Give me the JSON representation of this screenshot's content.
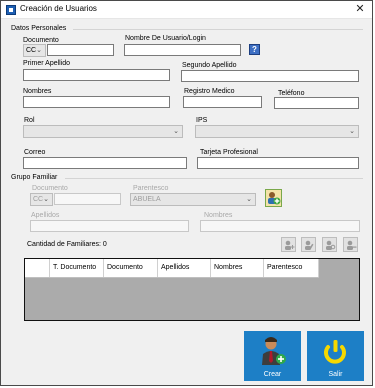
{
  "window": {
    "title": "Creación de Usuarios",
    "close_glyph": "✕"
  },
  "datos_personales": {
    "group_label": "Datos Personales",
    "documento_label": "Documento",
    "documento_tipo": "CC",
    "documento_value": "",
    "nombre_usuario_label": "Nombre De Usuario/Login",
    "nombre_usuario_value": "",
    "help_glyph": "?",
    "primer_apellido_label": "Primer Apellido",
    "segundo_apellido_label": "Segundo Apellido",
    "nombres_label": "Nombres",
    "registro_medico_label": "Registro Medico",
    "telefono_label": "Teléfono",
    "rol_label": "Rol",
    "rol_value": "",
    "ips_label": "IPS",
    "ips_value": "",
    "correo_label": "Correo",
    "tarjeta_profesional_label": "Tarjeta Profesional"
  },
  "grupo_familiar": {
    "group_label": "Grupo Familiar",
    "documento_label": "Documento",
    "documento_tipo": "CC",
    "parentesco_label": "Parentesco",
    "parentesco_value": "ABUELA",
    "apellidos_label": "Apellidos",
    "nombres_label": "Nombres",
    "cantidad_label": "Cantidad de Familiares: 0",
    "columns": [
      "T. Documento",
      "Documento",
      "Apellidos",
      "Nombres",
      "Parentesco"
    ]
  },
  "actions": {
    "crear_label": "Crear",
    "salir_label": "Salir"
  },
  "colors": {
    "accent_blue": "#1d7fc6",
    "window_bg": "#f0f0f0",
    "grid_bg": "#ababab"
  },
  "icons": {
    "app": "app-icon",
    "close": "close-icon",
    "help": "help-icon",
    "add_family": "add-family-icon",
    "family_actions": [
      "add-user-icon",
      "edit-user-icon",
      "search-user-icon",
      "remove-user-icon"
    ],
    "crear": "create-user-icon",
    "salir": "power-icon"
  }
}
